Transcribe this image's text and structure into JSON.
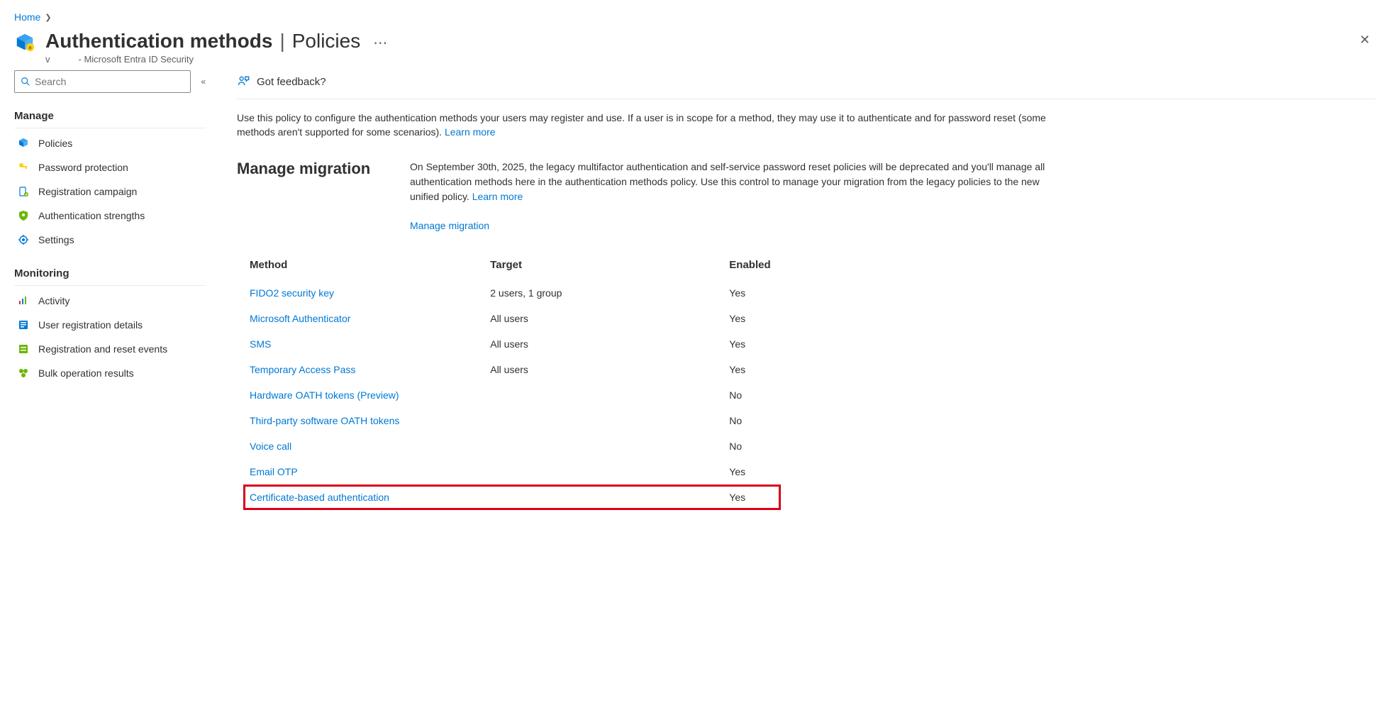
{
  "breadcrumb": {
    "home": "Home"
  },
  "header": {
    "title_main": "Authentication methods",
    "title_sub": "Policies",
    "subtitle_prefix": "v",
    "subtitle": "- Microsoft Entra ID Security"
  },
  "sidebar": {
    "search_placeholder": "Search",
    "groups": [
      {
        "title": "Manage",
        "items": [
          {
            "icon": "policies",
            "label": "Policies"
          },
          {
            "icon": "key",
            "label": "Password protection"
          },
          {
            "icon": "campaign",
            "label": "Registration campaign"
          },
          {
            "icon": "shield",
            "label": "Authentication strengths"
          },
          {
            "icon": "gear",
            "label": "Settings"
          }
        ]
      },
      {
        "title": "Monitoring",
        "items": [
          {
            "icon": "activity",
            "label": "Activity"
          },
          {
            "icon": "userreg",
            "label": "User registration details"
          },
          {
            "icon": "regreset",
            "label": "Registration and reset events"
          },
          {
            "icon": "bulk",
            "label": "Bulk operation results"
          }
        ]
      }
    ]
  },
  "toolbar": {
    "feedback": "Got feedback?"
  },
  "description": {
    "text": "Use this policy to configure the authentication methods your users may register and use. If a user is in scope for a method, they may use it to authenticate and for password reset (some methods aren't supported for some scenarios).",
    "learn_more": "Learn more"
  },
  "migration": {
    "title": "Manage migration",
    "text": "On September 30th, 2025, the legacy multifactor authentication and self-service password reset policies will be deprecated and you'll manage all authentication methods here in the authentication methods policy. Use this control to manage your migration from the legacy policies to the new unified policy.",
    "learn_more": "Learn more",
    "link": "Manage migration"
  },
  "table": {
    "headers": {
      "method": "Method",
      "target": "Target",
      "enabled": "Enabled"
    },
    "rows": [
      {
        "method": "FIDO2 security key",
        "target": "2 users, 1 group",
        "enabled": "Yes",
        "highlight": false
      },
      {
        "method": "Microsoft Authenticator",
        "target": "All users",
        "enabled": "Yes",
        "highlight": false
      },
      {
        "method": "SMS",
        "target": "All users",
        "enabled": "Yes",
        "highlight": false
      },
      {
        "method": "Temporary Access Pass",
        "target": "All users",
        "enabled": "Yes",
        "highlight": false
      },
      {
        "method": "Hardware OATH tokens (Preview)",
        "target": "",
        "enabled": "No",
        "highlight": false
      },
      {
        "method": "Third-party software OATH tokens",
        "target": "",
        "enabled": "No",
        "highlight": false
      },
      {
        "method": "Voice call",
        "target": "",
        "enabled": "No",
        "highlight": false
      },
      {
        "method": "Email OTP",
        "target": "",
        "enabled": "Yes",
        "highlight": false
      },
      {
        "method": "Certificate-based authentication",
        "target": "",
        "enabled": "Yes",
        "highlight": true
      }
    ]
  }
}
